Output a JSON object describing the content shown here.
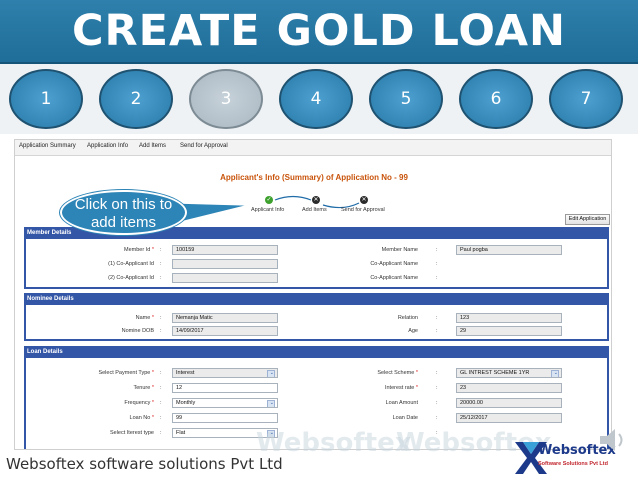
{
  "title": "CREATE GOLD LOAN",
  "steps": [
    "1",
    "2",
    "3",
    "4",
    "5",
    "6",
    "7"
  ],
  "active_step": "3",
  "app_nav": [
    "Application Summary",
    "Application Info",
    "Add Items",
    "Send for Approval"
  ],
  "app_heading": "Applicant's Info (Summary) of Application No - 99",
  "wizard": {
    "applicant_info": "Applicant Info",
    "add_items": "Add Items",
    "send_for_approval": "Send for Approval"
  },
  "edit_button": "Edit Application",
  "callout": "Click on this to add items",
  "member_details": {
    "header": "Member Details",
    "member_id_label": "Member Id",
    "member_id": "100159",
    "co_applicant_1_label": "(1) Co-Applicant Id",
    "co_applicant_1": "",
    "co_applicant_2_label": "(2) Co-Applicant Id",
    "co_applicant_2": "",
    "member_name_label": "Member Name",
    "member_name": "Paul pogba",
    "co_applicant_name_label": "Co-Applicant Name",
    "co_applicant_name_1": "",
    "co_applicant_name_2": ""
  },
  "nominee_details": {
    "header": "Nominee Details",
    "name_label": "Name",
    "name": "Nemanja Matic",
    "dob_label": "Nomine DOB",
    "dob": "14/09/2017",
    "relation_label": "Relation",
    "relation": "123",
    "age_label": "Age",
    "age": "29"
  },
  "loan_details": {
    "header": "Loan Details",
    "payment_type_label": "Select Payment Type",
    "payment_type": "Interest",
    "tenure_label": "Tenure",
    "tenure": "12",
    "frequency_label": "Frequency",
    "frequency": "Monthly",
    "loan_no_label": "Loan No",
    "loan_no": "99",
    "interest_type_label": "Select Iterest type",
    "interest_type": "Flat",
    "scheme_label": "Select Scheme",
    "scheme": "GL INTREST SCHEME 1YR",
    "interest_rate_label": "Interest rate",
    "interest_rate": "23",
    "loan_amount_label": "Loan Amount",
    "loan_amount": "20000.00",
    "loan_date_label": "Loan Date",
    "loan_date": "25/12/2017"
  },
  "footer": "Websoftex software solutions Pvt Ltd",
  "watermark": "Websoftex",
  "logo": {
    "name": "Websoftex",
    "subtitle": "Software Solutions Pvt Ltd"
  },
  "colors": {
    "banner": "#2f80ac",
    "step": "#2779a8",
    "step_active": "#a9b7c1",
    "section_header": "#3456a6",
    "heading": "#c8530a"
  }
}
